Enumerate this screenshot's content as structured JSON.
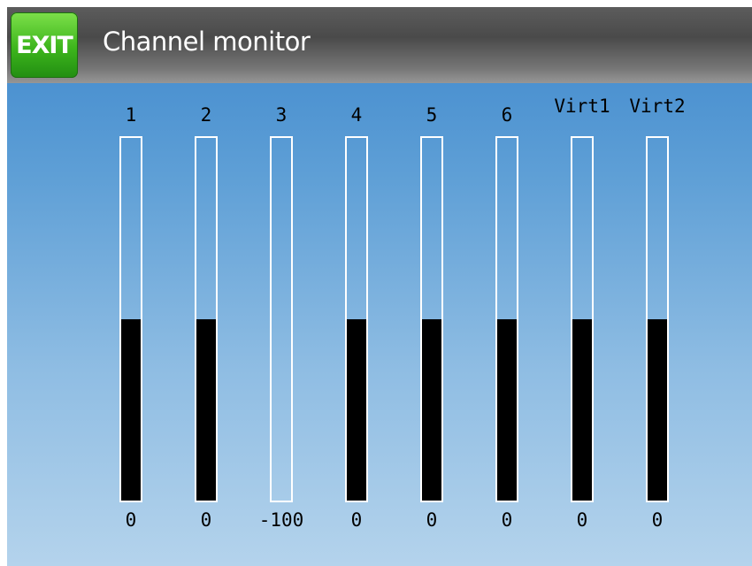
{
  "header": {
    "exit_label": "EXIT",
    "title": "Channel monitor"
  },
  "channels": [
    {
      "label": "1",
      "value": "0",
      "fill_fraction": 0.5
    },
    {
      "label": "2",
      "value": "0",
      "fill_fraction": 0.5
    },
    {
      "label": "3",
      "value": "-100",
      "fill_fraction": 0
    },
    {
      "label": "4",
      "value": "0",
      "fill_fraction": 0.5
    },
    {
      "label": "5",
      "value": "0",
      "fill_fraction": 0.5
    },
    {
      "label": "6",
      "value": "0",
      "fill_fraction": 0.5
    },
    {
      "label": "Virt1",
      "value": "0",
      "fill_fraction": 0.5
    },
    {
      "label": "Virt2",
      "value": "0",
      "fill_fraction": 0.5
    }
  ],
  "colors": {
    "exit_button": "#3db51c",
    "bar_outline": "#ffffff",
    "bar_fill": "#000000",
    "background_top": "#3d87cc",
    "background_bottom": "#b4d3ec"
  }
}
